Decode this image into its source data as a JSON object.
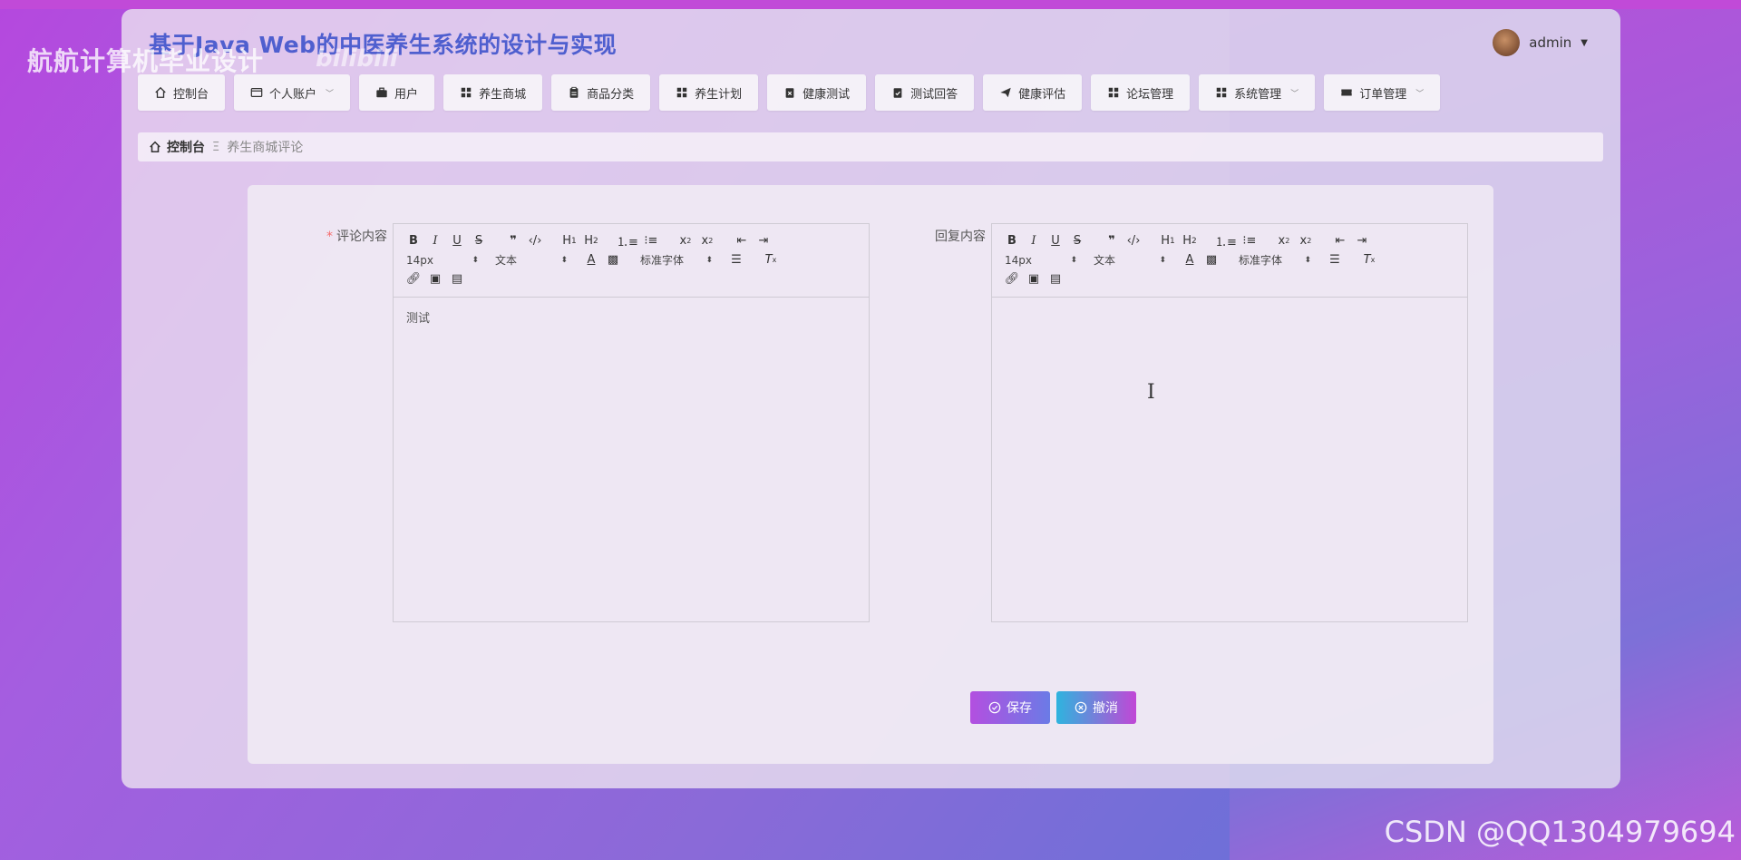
{
  "app": {
    "title": "基于Java Web的中医养生系统的设计与实现",
    "user": "admin"
  },
  "nav": [
    {
      "label": "控制台",
      "icon": "home-icon",
      "dropdown": false
    },
    {
      "label": "个人账户",
      "icon": "id-card-icon",
      "dropdown": true
    },
    {
      "label": "用户",
      "icon": "briefcase-icon",
      "dropdown": false
    },
    {
      "label": "养生商城",
      "icon": "grid-icon",
      "dropdown": false
    },
    {
      "label": "商品分类",
      "icon": "clipboard-icon",
      "dropdown": false
    },
    {
      "label": "养生计划",
      "icon": "grid-icon",
      "dropdown": false
    },
    {
      "label": "健康测试",
      "icon": "clipboard-x-icon",
      "dropdown": false
    },
    {
      "label": "测试回答",
      "icon": "clipboard-check-icon",
      "dropdown": false
    },
    {
      "label": "健康评估",
      "icon": "paper-plane-icon",
      "dropdown": false
    },
    {
      "label": "论坛管理",
      "icon": "grid-icon",
      "dropdown": false
    },
    {
      "label": "系统管理",
      "icon": "grid-icon",
      "dropdown": true
    },
    {
      "label": "订单管理",
      "icon": "ticket-icon",
      "dropdown": true
    }
  ],
  "breadcrumb": {
    "home": "控制台",
    "separator": "Ξ",
    "current": "养生商城评论"
  },
  "form": {
    "comment_label": "评论内容",
    "comment_required_mark": "*",
    "comment_content": "测试",
    "reply_label": "回复内容",
    "reply_content": ""
  },
  "toolbar": {
    "font_size": "14px",
    "header": "文本",
    "font_family": "标准字体"
  },
  "buttons": {
    "save": "保存",
    "cancel": "撤消"
  },
  "watermarks": {
    "top": "航航计算机毕业设计",
    "bili": "bilibili",
    "bottom": "CSDN @QQ1304979694"
  },
  "colors": {
    "title": "#4f5fcf",
    "save_gradient": [
      "#b34fe0",
      "#6b7be6"
    ],
    "cancel_gradient": [
      "#2eb4de",
      "#c147d6"
    ],
    "required": "#f56c6c"
  }
}
